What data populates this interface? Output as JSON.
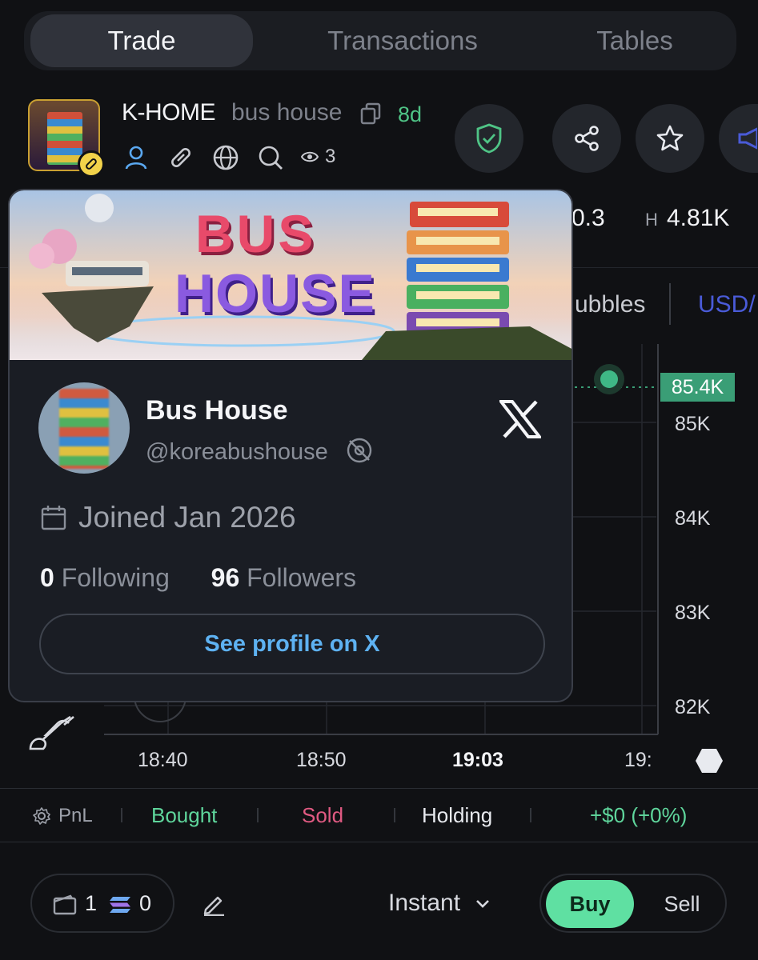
{
  "tabs": [
    {
      "label": "Trade",
      "active": true
    },
    {
      "label": "Transactions",
      "active": false
    },
    {
      "label": "Tables",
      "active": false
    }
  ],
  "token": {
    "symbol": "K-HOME",
    "name": "bus house",
    "age": "8d",
    "views": "3",
    "socials": [
      "person-icon",
      "link-icon",
      "globe-icon",
      "search-icon"
    ]
  },
  "header_actions": [
    "shield-check-icon",
    "share-icon",
    "star-icon",
    "megaphone-icon"
  ],
  "market": {
    "price_fragment": "0.3",
    "high_label": "H",
    "high_value": "4.81K"
  },
  "chart_controls": {
    "bubbles_fragment": "ubbles",
    "currency_fragment": "USD/"
  },
  "chart": {
    "current_price_tag": "85.4K",
    "y_labels": [
      "85K",
      "84K",
      "83K",
      "82K"
    ],
    "x_labels": [
      "18:40",
      "18:50",
      "19:03",
      "19:"
    ]
  },
  "pnl": {
    "label": "PnL",
    "bought": "Bought",
    "sold": "Sold",
    "holding": "Holding",
    "value": "+$0 (+0%)"
  },
  "bottom": {
    "wallet_count": "1",
    "sol_amount": "0",
    "mode": "Instant",
    "buy": "Buy",
    "sell": "Sell"
  },
  "profile_card": {
    "banner_text_top": "BUS",
    "banner_text_bottom": "HOUSE",
    "display_name": "Bus House",
    "handle": "@koreabushouse",
    "joined": "Joined Jan 2026",
    "following_count": "0",
    "following_label": "Following",
    "followers_count": "96",
    "followers_label": "Followers",
    "cta": "See profile on X"
  },
  "colors": {
    "accent_green": "#4fc486",
    "buy_green": "#5fe0a2",
    "sold_red": "#e05a82",
    "link_blue": "#5eb2f2"
  }
}
